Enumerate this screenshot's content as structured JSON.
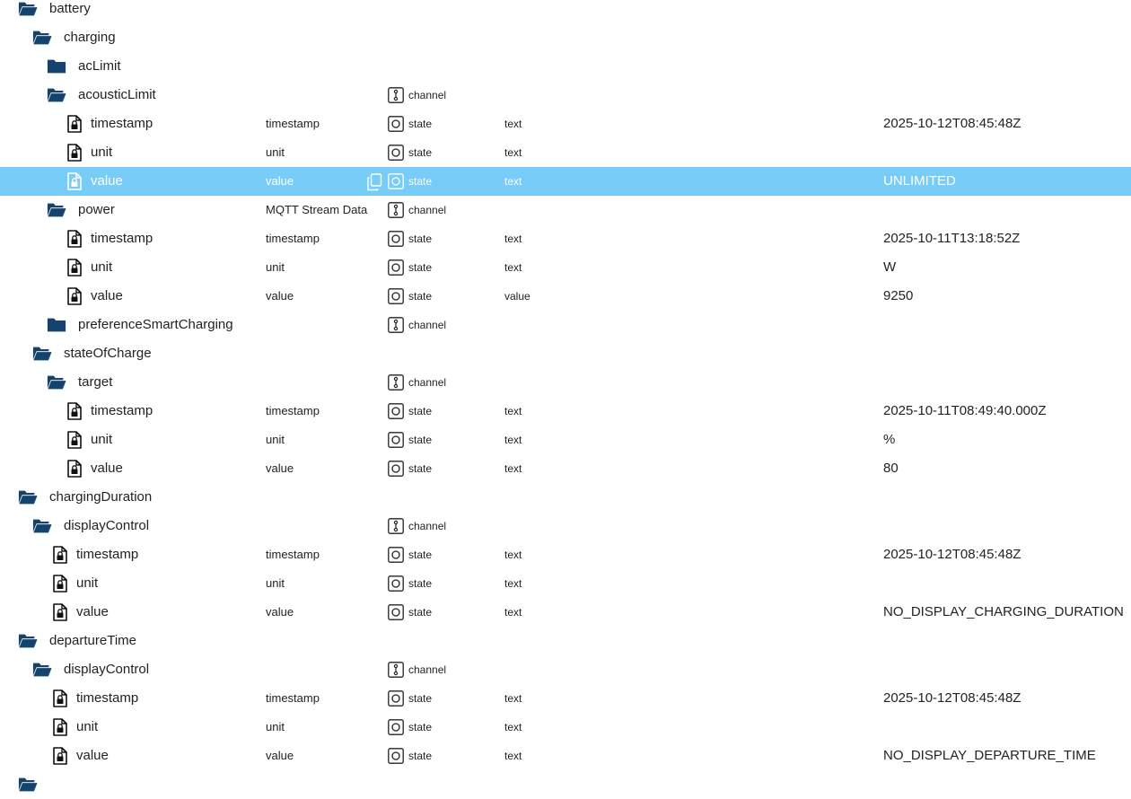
{
  "colors": {
    "folder": "#16426e",
    "selected_row_bg": "#77ccf8",
    "selected_text": "#ffffff",
    "text": "#222222"
  },
  "rows": [
    {
      "name": "battery",
      "icon": "folder-open-icon",
      "level": 0,
      "role": "",
      "type": "",
      "kind": "",
      "value": ""
    },
    {
      "name": "charging",
      "icon": "folder-open-icon",
      "level": 1,
      "role": "",
      "type": "",
      "kind": "",
      "value": ""
    },
    {
      "name": "acLimit",
      "icon": "folder-closed-icon",
      "level": 2,
      "role": "",
      "type": "",
      "kind": "",
      "value": ""
    },
    {
      "name": "acousticLimit",
      "icon": "folder-open-icon",
      "level": 2,
      "role": "",
      "type": "channel",
      "kind": "",
      "value": ""
    },
    {
      "name": "timestamp",
      "icon": "file-lock-icon",
      "level": 3,
      "role": "timestamp",
      "type": "state",
      "kind": "text",
      "value": "2025-10-12T08:45:48Z"
    },
    {
      "name": "unit",
      "icon": "file-lock-icon",
      "level": 3,
      "role": "unit",
      "type": "state",
      "kind": "text",
      "value": ""
    },
    {
      "name": "value",
      "icon": "file-lock-icon",
      "level": 3,
      "role": "value",
      "type": "state",
      "kind": "text",
      "value": "UNLIMITED",
      "selected": true
    },
    {
      "name": "power",
      "icon": "folder-open-icon",
      "level": 2,
      "role": "MQTT Stream Data",
      "type": "channel",
      "kind": "",
      "value": ""
    },
    {
      "name": "timestamp",
      "icon": "file-lock-icon",
      "level": 3,
      "role": "timestamp",
      "type": "state",
      "kind": "text",
      "value": "2025-10-11T13:18:52Z"
    },
    {
      "name": "unit",
      "icon": "file-lock-icon",
      "level": 3,
      "role": "unit",
      "type": "state",
      "kind": "text",
      "value": "W"
    },
    {
      "name": "value",
      "icon": "file-lock-icon",
      "level": 3,
      "role": "value",
      "type": "state",
      "kind": "value",
      "value": "9250"
    },
    {
      "name": "preferenceSmartCharging",
      "icon": "folder-closed-icon",
      "level": 2,
      "role": "",
      "type": "channel",
      "kind": "",
      "value": ""
    },
    {
      "name": "stateOfCharge",
      "icon": "folder-open-icon",
      "level": 1,
      "role": "",
      "type": "",
      "kind": "",
      "value": ""
    },
    {
      "name": "target",
      "icon": "folder-open-icon",
      "level": 2,
      "role": "",
      "type": "channel",
      "kind": "",
      "value": ""
    },
    {
      "name": "timestamp",
      "icon": "file-lock-icon",
      "level": 3,
      "role": "timestamp",
      "type": "state",
      "kind": "text",
      "value": "2025-10-11T08:49:40.000Z"
    },
    {
      "name": "unit",
      "icon": "file-lock-icon",
      "level": 3,
      "role": "unit",
      "type": "state",
      "kind": "text",
      "value": "%"
    },
    {
      "name": "value",
      "icon": "file-lock-icon",
      "level": 3,
      "role": "value",
      "type": "state",
      "kind": "text",
      "value": "80"
    },
    {
      "name": "chargingDuration",
      "icon": "folder-open-icon",
      "level": 0,
      "role": "",
      "type": "",
      "kind": "",
      "value": ""
    },
    {
      "name": "displayControl",
      "icon": "folder-open-icon",
      "level": 1,
      "role": "",
      "type": "channel",
      "kind": "",
      "value": ""
    },
    {
      "name": "timestamp",
      "icon": "file-lock-icon",
      "level": 2,
      "role": "timestamp",
      "type": "state",
      "kind": "text",
      "value": "2025-10-12T08:45:48Z"
    },
    {
      "name": "unit",
      "icon": "file-lock-icon",
      "level": 2,
      "role": "unit",
      "type": "state",
      "kind": "text",
      "value": ""
    },
    {
      "name": "value",
      "icon": "file-lock-icon",
      "level": 2,
      "role": "value",
      "type": "state",
      "kind": "text",
      "value": "NO_DISPLAY_CHARGING_DURATION"
    },
    {
      "name": "departureTime",
      "icon": "folder-open-icon",
      "level": 0,
      "role": "",
      "type": "",
      "kind": "",
      "value": ""
    },
    {
      "name": "displayControl",
      "icon": "folder-open-icon",
      "level": 1,
      "role": "",
      "type": "channel",
      "kind": "",
      "value": ""
    },
    {
      "name": "timestamp",
      "icon": "file-lock-icon",
      "level": 2,
      "role": "timestamp",
      "type": "state",
      "kind": "text",
      "value": "2025-10-12T08:45:48Z"
    },
    {
      "name": "unit",
      "icon": "file-lock-icon",
      "level": 2,
      "role": "unit",
      "type": "state",
      "kind": "text",
      "value": ""
    },
    {
      "name": "value",
      "icon": "file-lock-icon",
      "level": 2,
      "role": "value",
      "type": "state",
      "kind": "text",
      "value": "NO_DISPLAY_DEPARTURE_TIME"
    },
    {
      "name": "",
      "icon": "folder-open-icon",
      "level": 0,
      "role": "",
      "type": "",
      "kind": "",
      "value": ""
    }
  ]
}
